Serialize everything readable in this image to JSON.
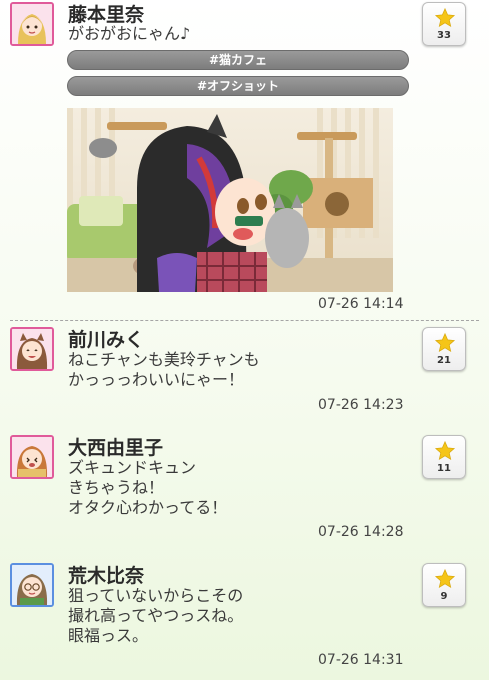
{
  "posts": [
    {
      "name": "藤本里奈",
      "message": "がおがおにゃん♪",
      "tags": [
        "#猫カフェ",
        "#オフショット"
      ],
      "likes": "33",
      "time": "07-26 14:14"
    },
    {
      "name": "前川みく",
      "message": "ねこチャンも美玲チャンも\nかっっっわいいにゃー！",
      "likes": "21",
      "time": "07-26 14:23"
    },
    {
      "name": "大西由里子",
      "message": "ズキュンドキュン\nきちゃうね！\nオタク心わかってる！",
      "likes": "11",
      "time": "07-26 14:28"
    },
    {
      "name": "荒木比奈",
      "message": "狙っていないからこその\n撮れ高ってやつっスね。\n眼福っス。",
      "likes": "9",
      "time": "07-26 14:31"
    }
  ],
  "colors": {
    "star": "#f5c518",
    "tag_bg": "#8a8a8a",
    "avatar_pink_border": "#e05a9a",
    "avatar_blue_border": "#5b8fe0"
  },
  "icons": {
    "like": "star-icon"
  }
}
